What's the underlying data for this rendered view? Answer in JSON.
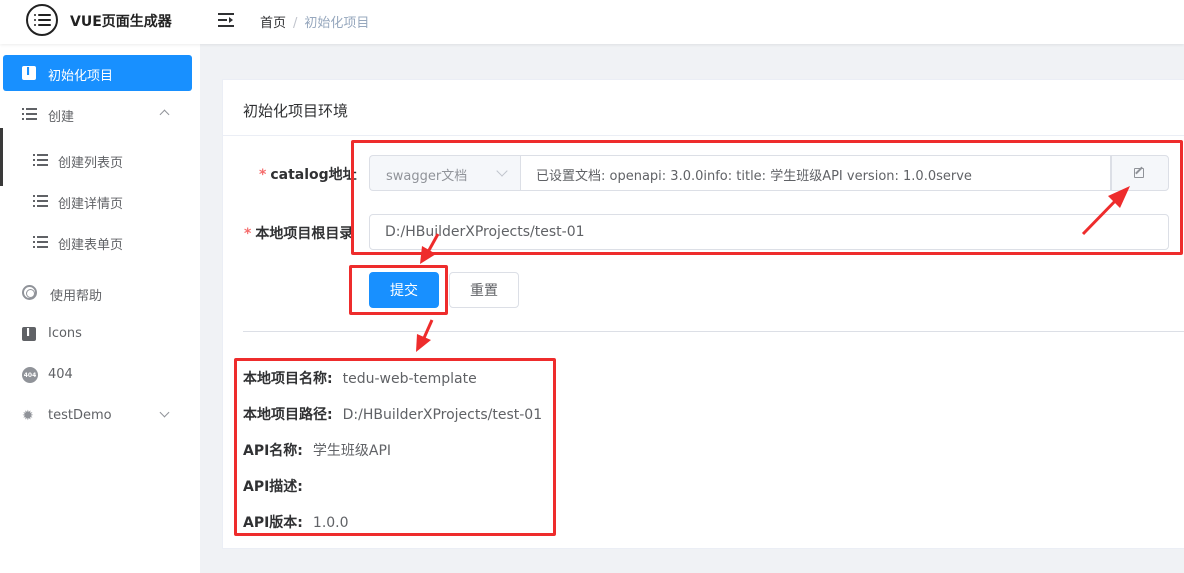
{
  "header": {
    "app_title": "VUE页面生成器",
    "breadcrumb": {
      "home": "首页",
      "separator": "/",
      "current": "初始化项目"
    }
  },
  "sidebar": {
    "items": [
      {
        "label": "初始化项目",
        "icon": "info-box-icon",
        "active": true
      },
      {
        "label": "创建",
        "icon": "list-icon",
        "expanded": true
      },
      {
        "label": "创建列表页",
        "icon": "list-icon",
        "sub": true
      },
      {
        "label": "创建详情页",
        "icon": "list-icon",
        "sub": true
      },
      {
        "label": "创建表单页",
        "icon": "list-icon",
        "sub": true
      },
      {
        "label": "使用帮助",
        "icon": "help-ring-icon"
      },
      {
        "label": "Icons",
        "icon": "info-box-icon"
      },
      {
        "label": "404",
        "icon": "404-badge-icon"
      },
      {
        "label": "testDemo",
        "icon": "bug-icon",
        "expanded": false
      }
    ]
  },
  "card": {
    "title": "初始化项目环境",
    "form": {
      "catalog_label": "catalog地址",
      "catalog_select_value": "swagger文档",
      "catalog_text": "已设置文档:  openapi: 3.0.0info:  title: 学生班级API  version: 1.0.0serve",
      "dir_label": "本地项目根目录",
      "dir_value": "D:/HBuilderXProjects/test-01",
      "required_mark": "*"
    },
    "buttons": {
      "submit": "提交",
      "reset": "重置"
    },
    "info": [
      {
        "key": "本地项目名称:",
        "value": "tedu-web-template"
      },
      {
        "key": "本地项目路径:",
        "value": "D:/HBuilderXProjects/test-01"
      },
      {
        "key": "API名称:",
        "value": "学生班级API"
      },
      {
        "key": "API描述:",
        "value": ""
      },
      {
        "key": "API版本:",
        "value": "1.0.0"
      }
    ]
  },
  "colors": {
    "primary": "#1890ff",
    "annotation": "#ee2c2c",
    "required": "#f56c6c"
  }
}
